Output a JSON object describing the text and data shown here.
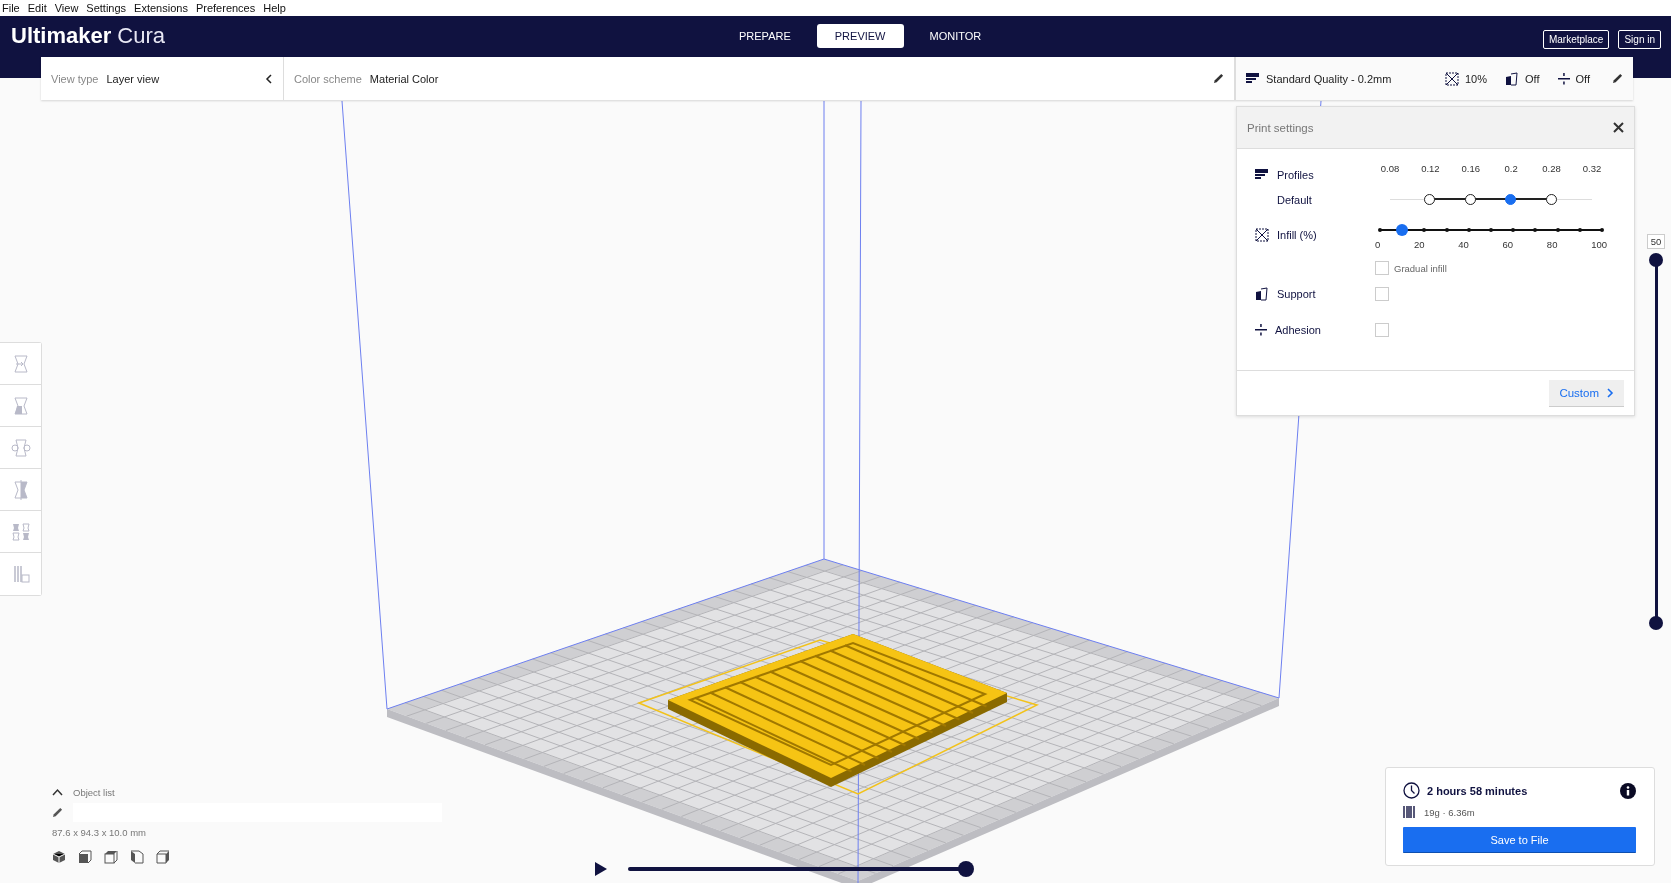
{
  "menu_bar": [
    {
      "label": "File"
    },
    {
      "label": "Edit"
    },
    {
      "label": "View"
    },
    {
      "label": "Settings"
    },
    {
      "label": "Extensions"
    },
    {
      "label": "Preferences"
    },
    {
      "label": "Help"
    }
  ],
  "header": {
    "logo_bold": "Ultimaker",
    "logo_light": "Cura",
    "tabs": [
      {
        "label": "PREPARE",
        "selected": false
      },
      {
        "label": "PREVIEW",
        "selected": true
      },
      {
        "label": "MONITOR",
        "selected": false
      }
    ],
    "buttons": [
      "Marketplace",
      "Sign in"
    ]
  },
  "view_bar": {
    "view_type_label": "View type",
    "view_type": "Layer view",
    "color_scheme_label": "Color scheme",
    "color_scheme": "Material Color"
  },
  "print_summary": {
    "profile": "Standard Quality - 0.2mm",
    "infill": "10%",
    "support": "Off",
    "adhesion": "Off"
  },
  "print_settings": {
    "title": "Print settings",
    "profiles_label": "Profiles",
    "profile_name": "Default",
    "layer_heights": [
      {
        "label": "0.08",
        "available": false,
        "selected": false
      },
      {
        "label": "0.12",
        "available": true,
        "selected": false
      },
      {
        "label": "0.16",
        "available": true,
        "selected": false
      },
      {
        "label": "0.2",
        "available": true,
        "selected": true
      },
      {
        "label": "0.28",
        "available": true,
        "selected": false
      },
      {
        "label": "0.32",
        "available": false,
        "selected": false
      }
    ],
    "infill_label": "Infill (%)",
    "infill": {
      "level": 0.1,
      "ticks": [
        "0",
        "20",
        "40",
        "60",
        "80",
        "100"
      ]
    },
    "gradual_infill": {
      "label": "Gradual infill",
      "checked": false
    },
    "support": {
      "label": "Support",
      "checked": false
    },
    "adhesion": {
      "label": "Adhesion",
      "checked": false
    },
    "custom_button": "Custom"
  },
  "layer_slider": {
    "label": "50",
    "level": 1
  },
  "path_slider": {
    "level": 1
  },
  "object_list": {
    "title": "Object list",
    "dimensions": "87.6 x 94.3 x 10.0 mm"
  },
  "job": {
    "time": "2 hours 58 minutes",
    "material": "19g · 6.36m",
    "action": "Save to File"
  }
}
